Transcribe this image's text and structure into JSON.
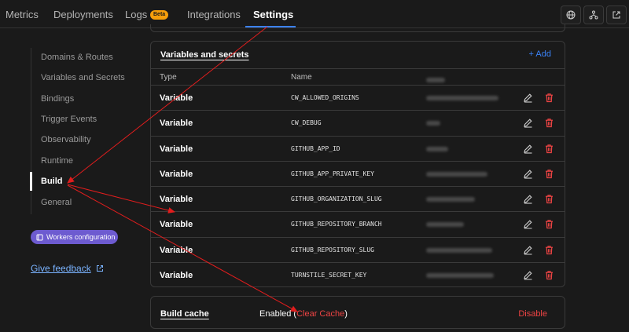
{
  "tabs": [
    {
      "label": "Metrics"
    },
    {
      "label": "Deployments"
    },
    {
      "label": "Logs",
      "badge": "Beta"
    },
    {
      "label": "Integrations"
    },
    {
      "label": "Settings"
    }
  ],
  "toolbar_icons": [
    "globe-icon",
    "branch-icon",
    "external-link-icon"
  ],
  "sidebar": {
    "items": [
      {
        "label": "Domains & Routes"
      },
      {
        "label": "Variables and Secrets"
      },
      {
        "label": "Bindings"
      },
      {
        "label": "Trigger Events"
      },
      {
        "label": "Observability"
      },
      {
        "label": "Runtime"
      },
      {
        "label": "Build"
      },
      {
        "label": "General"
      }
    ],
    "active": "Build",
    "workers_config_label": "Workers configuration",
    "feedback_label": "Give feedback"
  },
  "variables": {
    "title": "Variables and secrets",
    "add_label": "+ Add",
    "columns": {
      "type": "Type",
      "name": "Name"
    },
    "rows": [
      {
        "type": "Variable",
        "name": "CW_ALLOWED_ORIGINS"
      },
      {
        "type": "Variable",
        "name": "CW_DEBUG"
      },
      {
        "type": "Variable",
        "name": "GITHUB_APP_ID"
      },
      {
        "type": "Variable",
        "name": "GITHUB_APP_PRIVATE_KEY"
      },
      {
        "type": "Variable",
        "name": "GITHUB_ORGANIZATION_SLUG"
      },
      {
        "type": "Variable",
        "name": "GITHUB_REPOSITORY_BRANCH"
      },
      {
        "type": "Variable",
        "name": "GITHUB_REPOSITORY_SLUG"
      },
      {
        "type": "Variable",
        "name": "TURNSTILE_SECRET_KEY"
      }
    ]
  },
  "build_cache": {
    "label": "Build cache",
    "status_prefix": "Enabled (",
    "clear_label": "Clear Cache",
    "status_suffix": ")",
    "disable_label": "Disable"
  },
  "colors": {
    "background": "#1a1a1a",
    "accent": "#3b82f6",
    "danger": "#ef4444",
    "workers_button": "#6d5bd0",
    "beta_badge": "#f59e0b",
    "annotation_arrow": "#e11d1d"
  }
}
